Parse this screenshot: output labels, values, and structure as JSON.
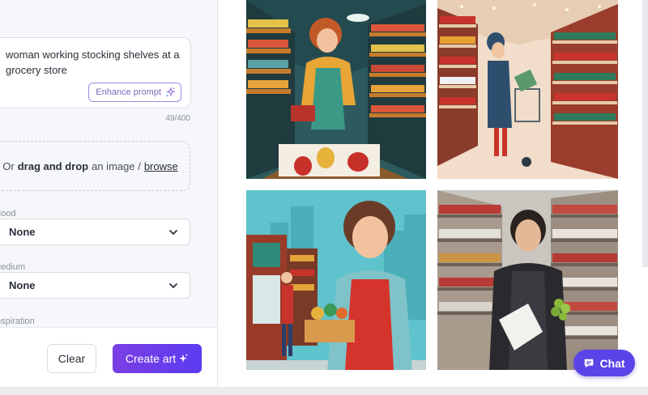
{
  "prompt": {
    "text": "woman working stocking shelves at a grocery store",
    "enhance_label": "Enhance prompt",
    "char_count": "49/400"
  },
  "upload": {
    "prefix": "Or",
    "bold": "drag and drop",
    "middle": "an image /",
    "link": "browse"
  },
  "fields": {
    "mood": {
      "label": "Mood",
      "value": "None"
    },
    "medium": {
      "label": "Medium",
      "value": "None"
    },
    "inspiration": {
      "label": "Inspiration"
    }
  },
  "actions": {
    "clear_label": "Clear",
    "create_label": "Create art"
  },
  "chat": {
    "label": "Chat"
  },
  "colors": {
    "accent": "#5b3bf0",
    "accent_start": "#7b3fe4",
    "enhance_border": "#9f8bd8"
  },
  "icons": [
    "sparkle-icon",
    "chevron-down-icon",
    "chat-bubble-icon"
  ]
}
